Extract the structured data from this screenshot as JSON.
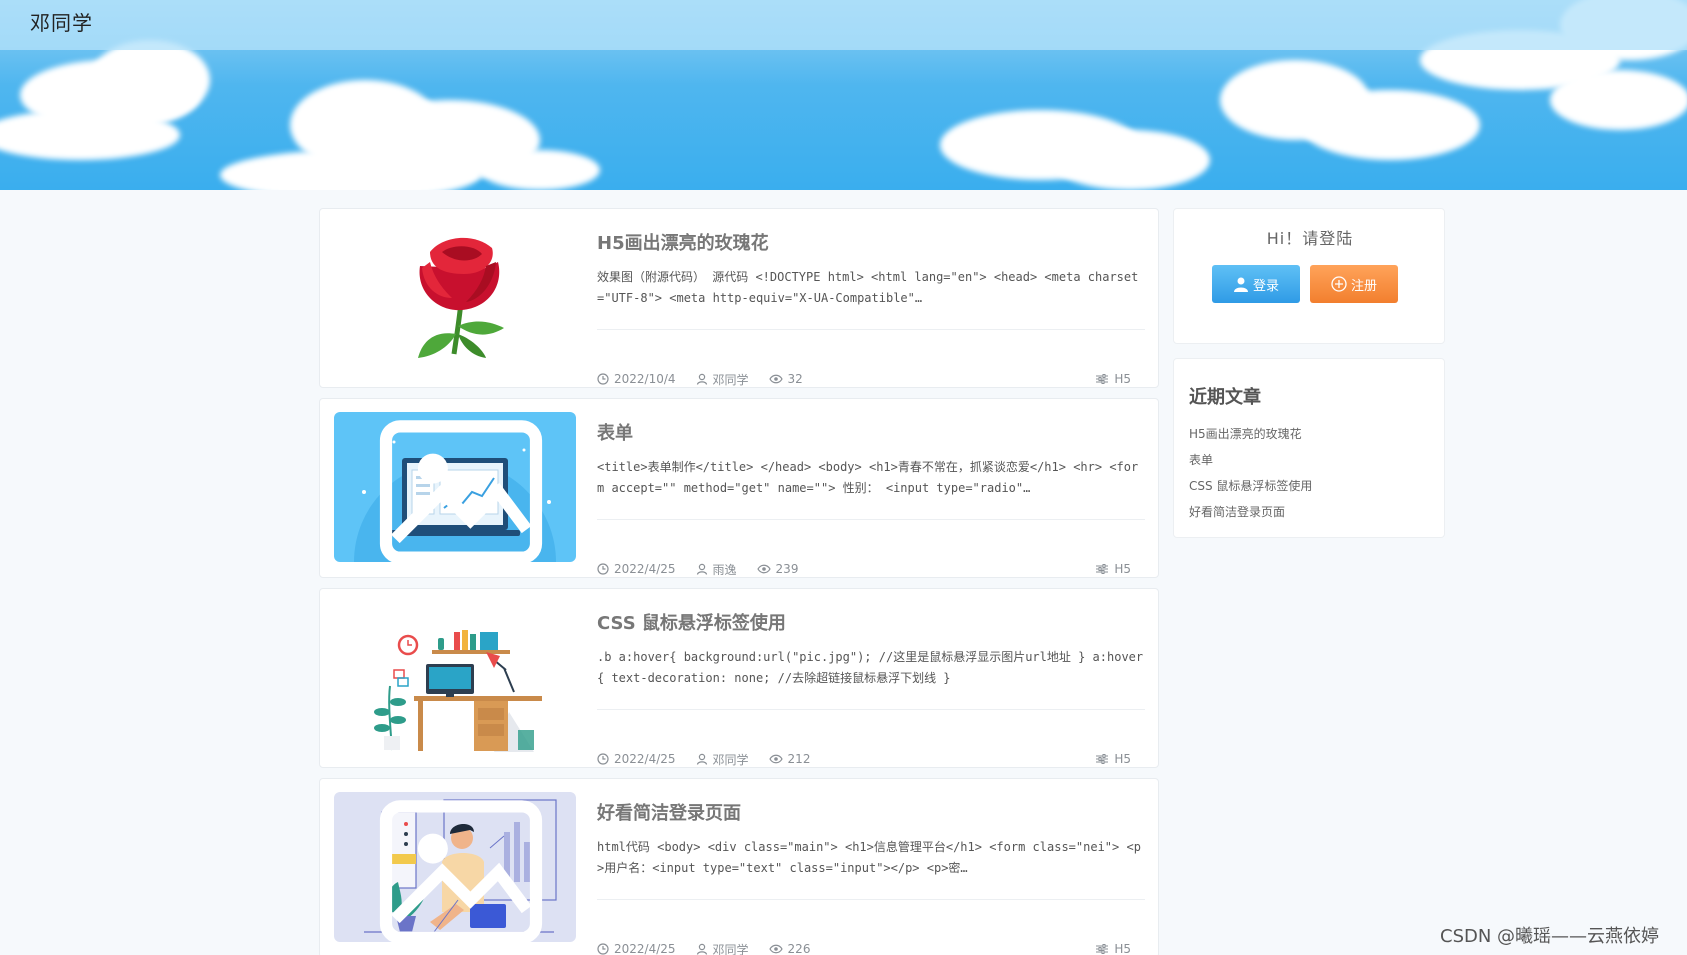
{
  "header": {
    "site_title": "邓同学"
  },
  "articles": [
    {
      "title": "H5画出漂亮的玫瑰花",
      "excerpt": "效果图（附源代码）  源代码 <!DOCTYPE html> <html lang=\"en\"> <head> <meta charset=\"UTF-8\">     <meta http-equiv=\"X-UA-Compatible\"…",
      "date": "2022/10/4",
      "author": "邓同学",
      "views": "32",
      "tag": "H5",
      "thumb_icon": "rose-illustration"
    },
    {
      "title": "表单",
      "excerpt": "<title>表单制作</title> </head> <body> <h1>青春不常在，抓紧谈恋爱</h1> <hr> <form accept=\"\" method=\"get\" name=\"\"> 性别： <input type=\"radio\"…",
      "date": "2022/4/25",
      "author": "雨逸",
      "views": "239",
      "tag": "H5",
      "thumb_icon": "laptop-chart-illustration"
    },
    {
      "title": "CSS 鼠标悬浮标签使用",
      "excerpt": ".b a:hover{ background:url(\"pic.jpg\"); //这里是鼠标悬浮显示图片url地址 } a:hover{ text-decoration: none; //去除超链接鼠标悬浮下划线 }",
      "date": "2022/4/25",
      "author": "邓同学",
      "views": "212",
      "tag": "H5",
      "thumb_icon": "desk-workspace-illustration"
    },
    {
      "title": "好看简洁登录页面",
      "excerpt": "html代码 <body> <div class=\"main\"> <h1>信息管理平台</h1> <form class=\"nei\"> <p>用户名：<input type=\"text\" class=\"input\"></p> <p>密…",
      "date": "2022/4/25",
      "author": "邓同学",
      "views": "226",
      "tag": "H5",
      "thumb_icon": "person-dashboard-illustration"
    }
  ],
  "sidebar": {
    "login": {
      "title": "Hi！请登陆",
      "login_label": "登录",
      "register_label": "注册"
    },
    "recent": {
      "title": "近期文章",
      "items": [
        "H5画出漂亮的玫瑰花",
        "表单",
        "CSS 鼠标悬浮标签使用",
        "好看简洁登录页面"
      ]
    }
  },
  "watermark": "CSDN @曦瑶——云燕依婷",
  "colors": {
    "login_button": "#2f9be6",
    "register_button": "#f27f2e",
    "sky": "#3aaeee"
  }
}
